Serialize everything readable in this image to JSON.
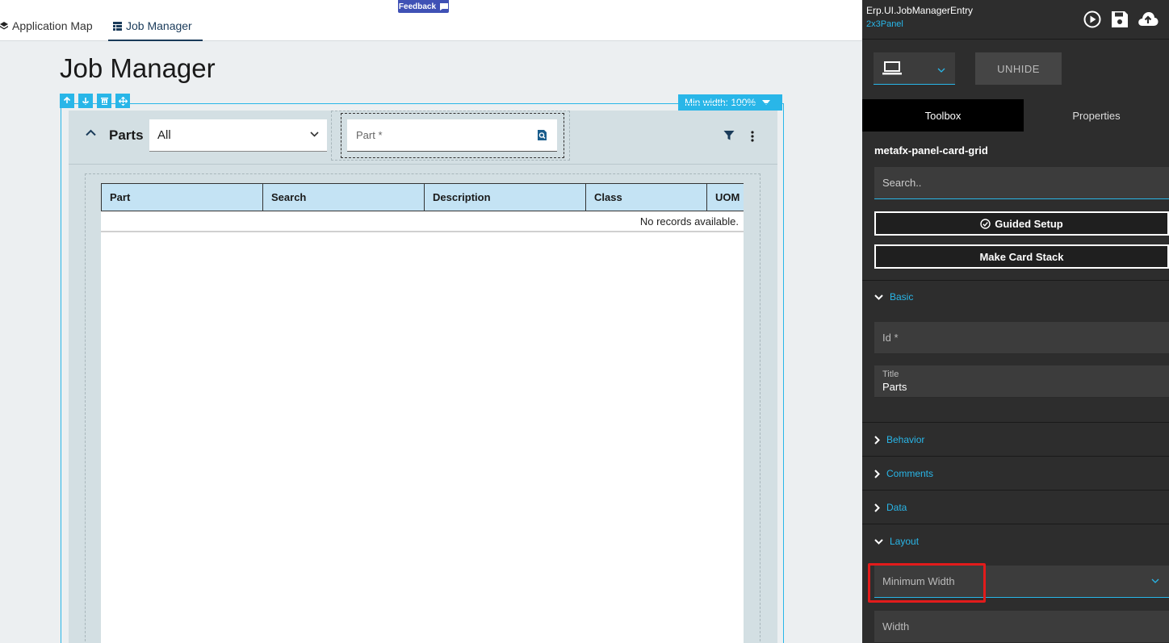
{
  "nav": {
    "tabs": [
      {
        "label": "Application Map",
        "icon": "layers-icon"
      },
      {
        "label": "Job Manager",
        "icon": "grid-icon",
        "active": true
      }
    ],
    "feedback_label": "Feedback"
  },
  "page": {
    "title": "Job Manager",
    "toolbar_icons": [
      "arrow-up-icon",
      "arrow-down-icon",
      "trash-icon",
      "move-icon"
    ],
    "min_width_label": "Min width: 100%"
  },
  "panel": {
    "title": "Parts",
    "filter_value": "All",
    "part_placeholder": "Part *",
    "grid": {
      "columns": [
        "Part",
        "Search",
        "Description",
        "Class",
        "UOM"
      ],
      "empty_message": "No records available."
    }
  },
  "designer": {
    "app_name": "Erp.UI.JobManagerEntry",
    "layout_name": "2x3Panel",
    "unhide_label": "UNHIDE",
    "tabs": {
      "toolbox": "Toolbox",
      "properties": "Properties"
    },
    "component_name": "metafx-panel-card-grid",
    "search_placeholder": "Search..",
    "guided_setup_label": "Guided Setup",
    "card_stack_label": "Make Card Stack",
    "sections": {
      "basic": "Basic",
      "behavior": "Behavior",
      "comments": "Comments",
      "data": "Data",
      "layout": "Layout"
    },
    "fields": {
      "id_label": "Id *",
      "title_label": "Title",
      "title_value": "Parts",
      "min_width_label": "Minimum Width",
      "width_label": "Width"
    }
  },
  "colors": {
    "accent": "#29b6e8",
    "nav_active": "#1a3b5a",
    "grid_header": "#c4e3f4",
    "highlight": "#e21b1b",
    "designer_bg": "#2d2d2d"
  }
}
